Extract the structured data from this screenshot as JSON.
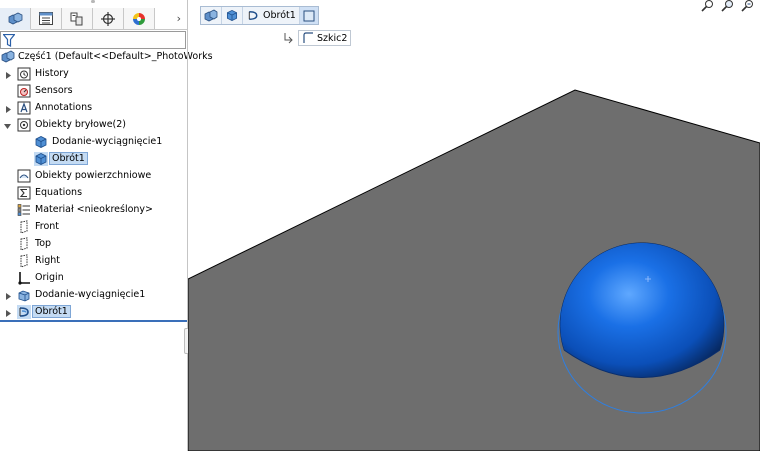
{
  "feature_manager": {
    "tabs": [
      {
        "name": "feature-manager-tab",
        "icon": "parts-icon"
      },
      {
        "name": "property-manager-tab",
        "icon": "list-icon"
      },
      {
        "name": "configuration-manager-tab",
        "icon": "config-icon"
      },
      {
        "name": "dimxpert-tab",
        "icon": "crosshair-icon"
      },
      {
        "name": "display-manager-tab",
        "icon": "color-wheel-icon"
      }
    ],
    "more_label": "›",
    "root_label": "Część1  (Default<<Default>_PhotoWorks",
    "items": [
      {
        "label": "History"
      },
      {
        "label": "Sensors"
      },
      {
        "label": "Annotations"
      },
      {
        "label": "Obiekty bryłowe(2)"
      },
      {
        "label": "Dodanie-wyciągnięcie1"
      },
      {
        "label": "Obrót1"
      },
      {
        "label": "Obiekty powierzchniowe"
      },
      {
        "label": "Equations"
      },
      {
        "label": "Materiał <nieokreślony>"
      },
      {
        "label": "Front"
      },
      {
        "label": "Top"
      },
      {
        "label": "Right"
      },
      {
        "label": "Origin"
      },
      {
        "label": "Dodanie-wyciągnięcie1"
      },
      {
        "label": "Obrót1"
      }
    ]
  },
  "breadcrumb": {
    "feature_label": "Obrót1",
    "sketch_label": "Szkic2"
  },
  "colors": {
    "sphere": "#1a66d6",
    "plane": "#6e6e6e",
    "selection": "#c4dbf3",
    "rollback_bar": "#3a6fb9"
  }
}
